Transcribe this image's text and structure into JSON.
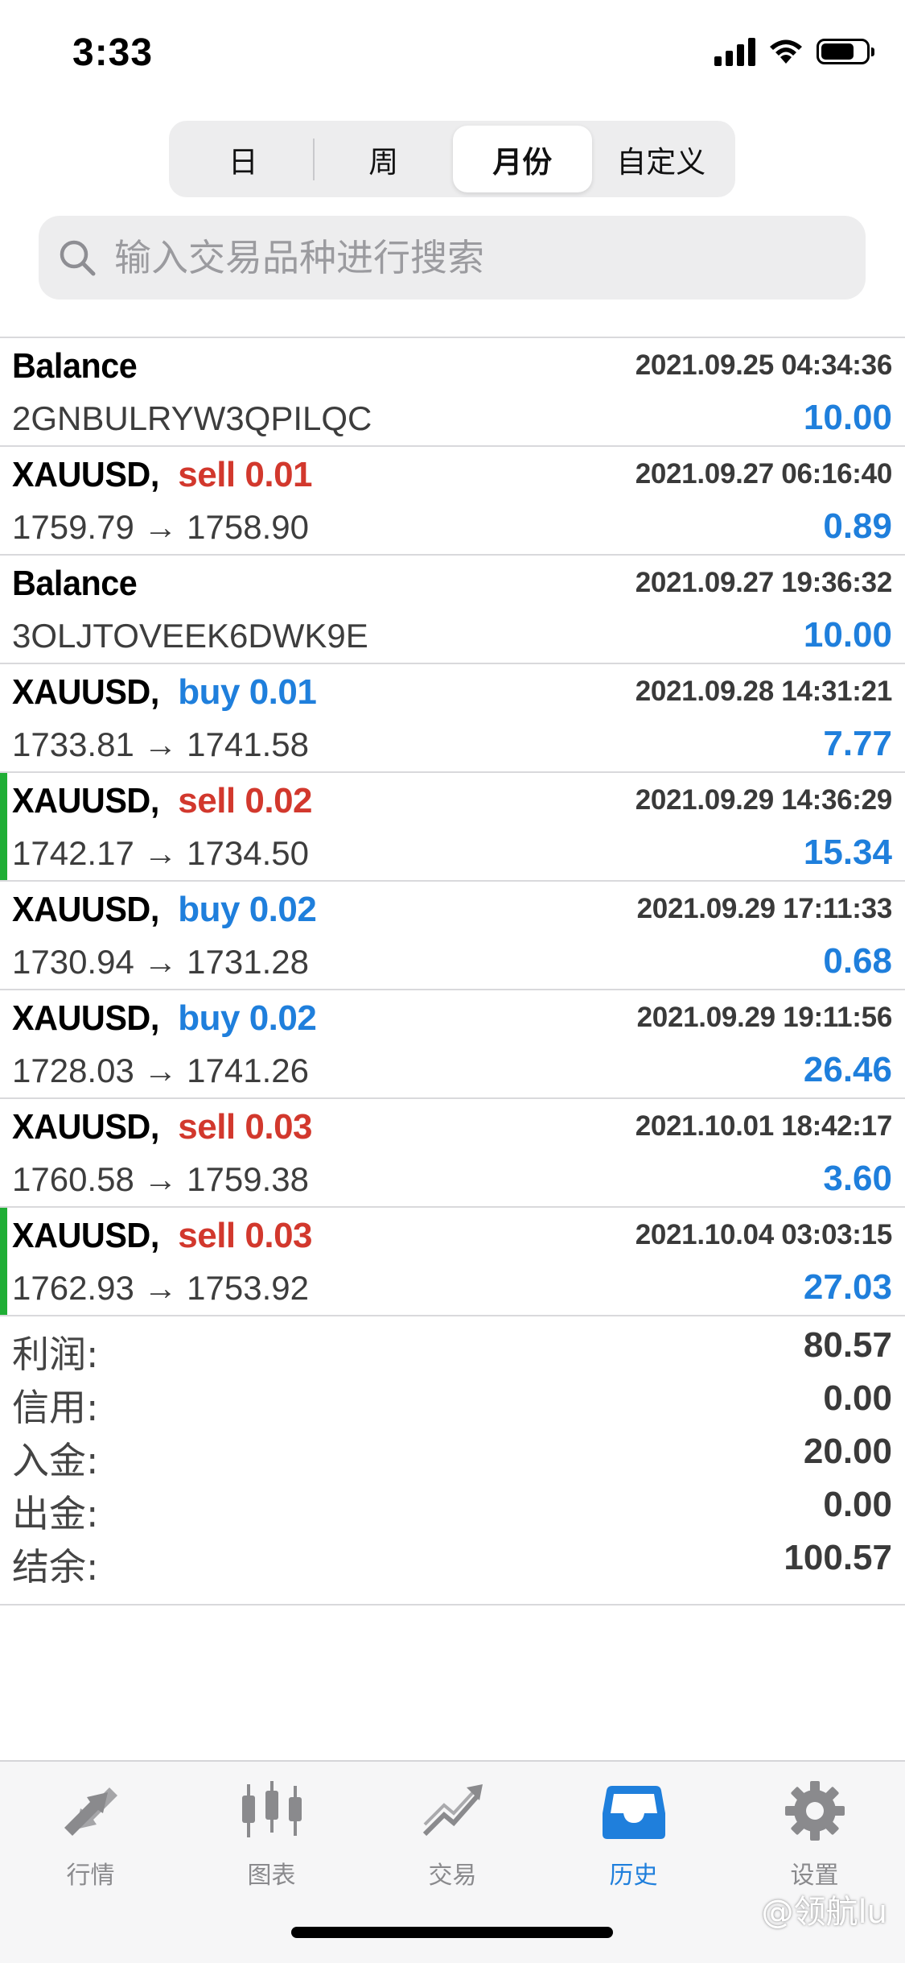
{
  "status_bar": {
    "time": "3:33"
  },
  "segment": {
    "items": [
      {
        "label": "日"
      },
      {
        "label": "周"
      },
      {
        "label": "月份"
      },
      {
        "label": "自定义"
      }
    ],
    "selected": "月份"
  },
  "search": {
    "placeholder": "输入交易品种进行搜索"
  },
  "rows": [
    {
      "title": "Balance",
      "side": "",
      "date": "2021.09.25 04:34:36",
      "sub": "2GNBULRYW3QPILQC",
      "amount": "10.00"
    },
    {
      "title": "XAUUSD,",
      "side": "sell 0.01",
      "date": "2021.09.27 06:16:40",
      "sub": "1759.79 → 1758.90",
      "amount": "0.89"
    },
    {
      "title": "Balance",
      "side": "",
      "date": "2021.09.27 19:36:32",
      "sub": "3OLJTOVEEK6DWK9E",
      "amount": "10.00"
    },
    {
      "title": "XAUUSD,",
      "side": "buy 0.01",
      "date": "2021.09.28 14:31:21",
      "sub": "1733.81 → 1741.58",
      "amount": "7.77"
    },
    {
      "title": "XAUUSD,",
      "side": "sell 0.02",
      "date": "2021.09.29 14:36:29",
      "sub": "1742.17 → 1734.50",
      "amount": "15.34"
    },
    {
      "title": "XAUUSD,",
      "side": "buy 0.02",
      "date": "2021.09.29 17:11:33",
      "sub": "1730.94 → 1731.28",
      "amount": "0.68"
    },
    {
      "title": "XAUUSD,",
      "side": "buy 0.02",
      "date": "2021.09.29 19:11:56",
      "sub": "1728.03 → 1741.26",
      "amount": "26.46"
    },
    {
      "title": "XAUUSD,",
      "side": "sell 0.03",
      "date": "2021.10.01 18:42:17",
      "sub": "1760.58 → 1759.38",
      "amount": "3.60"
    },
    {
      "title": "XAUUSD,",
      "side": "sell 0.03",
      "date": "2021.10.04 03:03:15",
      "sub": "1762.93 → 1753.92",
      "amount": "27.03"
    }
  ],
  "summary": {
    "profit": {
      "label": "利润:",
      "value": "80.57"
    },
    "credit": {
      "label": "信用:",
      "value": "0.00"
    },
    "deposit": {
      "label": "入金:",
      "value": "20.00"
    },
    "withdrawal": {
      "label": "出金:",
      "value": "0.00"
    },
    "balance": {
      "label": "结余:",
      "value": "100.57"
    }
  },
  "tabs": [
    {
      "label": "行情",
      "icon": "quotes-icon"
    },
    {
      "label": "图表",
      "icon": "chart-icon"
    },
    {
      "label": "交易",
      "icon": "trade-icon"
    },
    {
      "label": "历史",
      "icon": "history-icon"
    },
    {
      "label": "设置",
      "icon": "settings-icon"
    }
  ],
  "active_tab": "历史",
  "watermark": "@领航lu",
  "colors": {
    "sell": "#d2382d",
    "buy": "#1f7fdc",
    "profit": "#1f7fdc",
    "marker": "#1fae35",
    "active_tab": "#1f7fdc"
  }
}
